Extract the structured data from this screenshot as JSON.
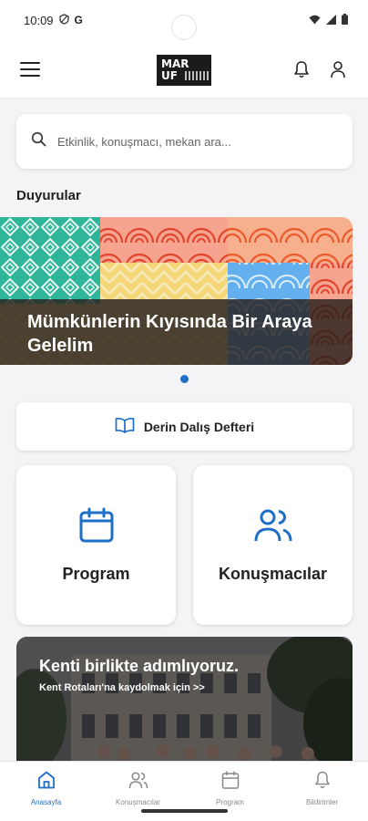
{
  "status_bar": {
    "time": "10:09",
    "icons_left": [
      "shield-icon",
      "google-icon"
    ],
    "icons_right": [
      "wifi-icon",
      "signal-icon",
      "battery-icon"
    ]
  },
  "header": {
    "logo_line1": "MAR",
    "logo_line2": "UF",
    "icons": [
      "menu-icon",
      "bell-icon",
      "user-icon"
    ]
  },
  "search": {
    "placeholder": "Etkinlik, konuşmacı, mekan ara...",
    "value": ""
  },
  "announcements": {
    "title": "Duyurular",
    "banner_text": "Mümkünlerin Kıyısında Bir Araya Gelelim",
    "active_dot": 1
  },
  "deep_dive": {
    "label": "Derin Dalış Defteri",
    "icon": "book-open-icon"
  },
  "tiles": [
    {
      "label": "Program",
      "icon": "calendar-icon"
    },
    {
      "label": "Konuşmacılar",
      "icon": "users-icon"
    }
  ],
  "promo": {
    "title": "Kenti birlikte adımlıyoruz.",
    "subtitle": "Kent Rotaları'na kaydolmak için >>"
  },
  "bottom_nav": [
    {
      "label": "Anasayfa",
      "icon": "home-icon",
      "active": true
    },
    {
      "label": "Konuşmacılar",
      "icon": "users-icon",
      "active": false
    },
    {
      "label": "Program",
      "icon": "calendar-icon",
      "active": false
    },
    {
      "label": "Bildirimler",
      "icon": "bell-icon",
      "active": false
    }
  ],
  "colors": {
    "accent": "#1e6fc7",
    "background": "#f4f4f6",
    "card": "#ffffff",
    "text": "#222222"
  }
}
